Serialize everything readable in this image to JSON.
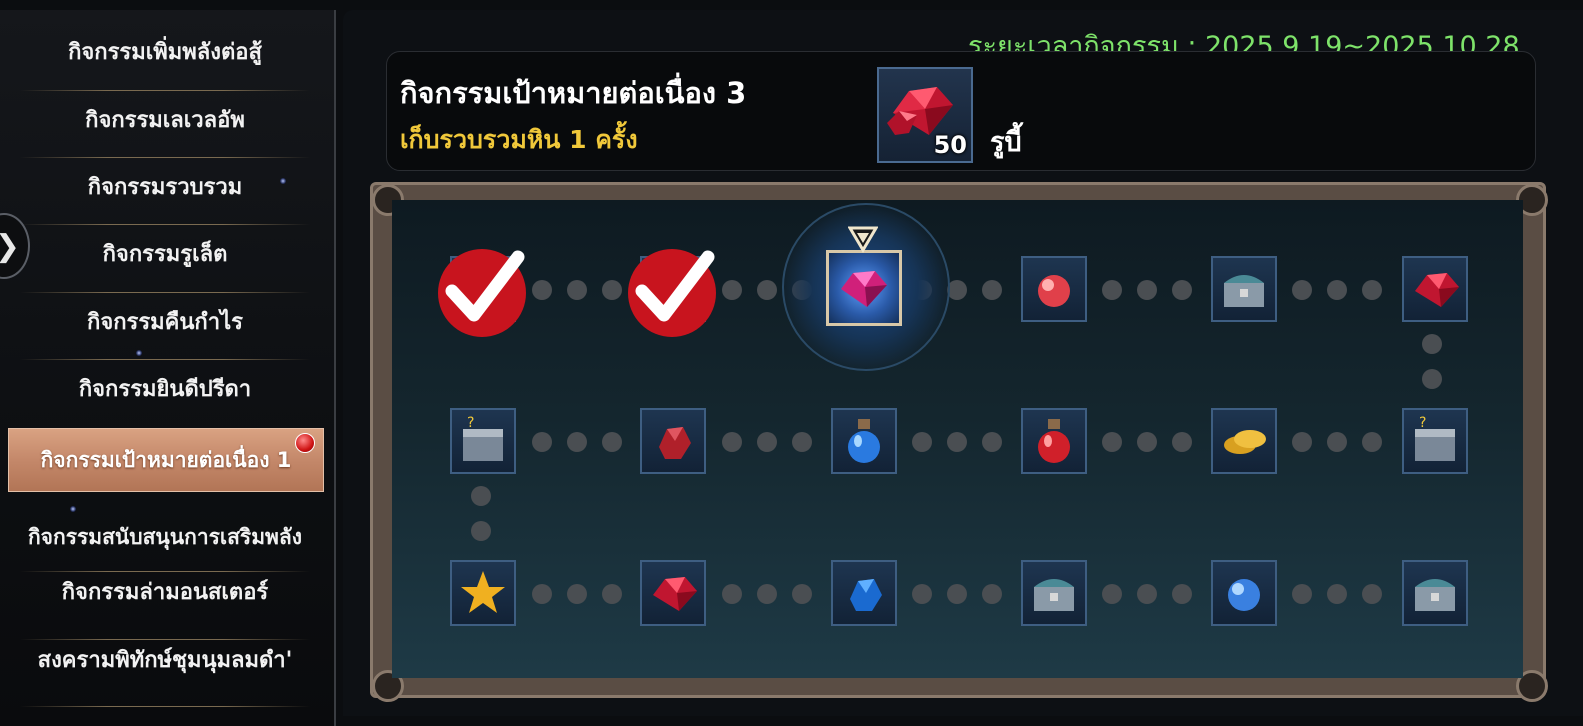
{
  "sidebar": {
    "items": [
      {
        "label": "กิจกรรมเพิ่มพลังต่อสู้"
      },
      {
        "label": "กิจกรรมเลเวลอัพ"
      },
      {
        "label": "กิจกรรมรวบรวม"
      },
      {
        "label": "กิจกรรมรูเล็ต"
      },
      {
        "label": "กิจกรรมคืนกำไร"
      },
      {
        "label": "กิจกรรมยินดีปรีดา"
      },
      {
        "label": "กิจกรรมเป้าหมายต่อเนื่อง 1",
        "active": true,
        "badge": "red-dot"
      },
      {
        "label": "กิจกรรมสนับสนุนการเสริมพลัง"
      },
      {
        "label": "กิจกรรมล่ามอนสเตอร์"
      },
      {
        "label": "สงครามพิทักษ์ชุมนุมลมดำ'"
      }
    ],
    "collapse_icon": "chevron-right-icon"
  },
  "header": {
    "period": "ระยะเวลากิจกรรม : 2025.9.19~2025.10.28"
  },
  "mission": {
    "title": "กิจกรรมเป้าหมายต่อเนื่อง 3",
    "description": "เก็บรวบรวมหิน 1 ครั้ง",
    "reward": {
      "icon": "ruby-icon",
      "quantity": "50",
      "name": "รูบี้"
    }
  },
  "board": {
    "rows": [
      [
        {
          "icon": "potion-bottle-icon",
          "status": "completed"
        },
        {
          "icon": "potion-bottle-icon",
          "status": "completed"
        },
        {
          "icon": "pink-gem-icon",
          "status": "current"
        },
        {
          "icon": "red-orb-icon",
          "status": "locked"
        },
        {
          "icon": "silver-chest-icon",
          "status": "locked"
        },
        {
          "icon": "ruby-icon",
          "status": "locked"
        }
      ],
      [
        {
          "icon": "mystery-box-icon",
          "status": "locked"
        },
        {
          "icon": "red-ore-icon",
          "status": "locked"
        },
        {
          "icon": "blue-potion-icon",
          "status": "locked"
        },
        {
          "icon": "red-potion-icon",
          "status": "locked"
        },
        {
          "icon": "gold-coins-icon",
          "status": "locked"
        },
        {
          "icon": "mystery-box-icon",
          "status": "locked"
        }
      ],
      [
        {
          "icon": "star-icon",
          "status": "locked"
        },
        {
          "icon": "ruby-icon",
          "status": "locked"
        },
        {
          "icon": "blue-ore-icon",
          "status": "locked"
        },
        {
          "icon": "silver-chest-icon",
          "status": "locked"
        },
        {
          "icon": "blue-orb-icon",
          "status": "locked"
        },
        {
          "icon": "silver-chest-icon",
          "status": "locked"
        }
      ]
    ],
    "current_marker": "pointer-down-icon",
    "completed_marker": "check-mark-icon"
  },
  "colors": {
    "period_text": "#7ee36a",
    "mission_desc": "#f0c83a",
    "active_tab": "#c4886a",
    "tile_border": "#3e5e82"
  }
}
